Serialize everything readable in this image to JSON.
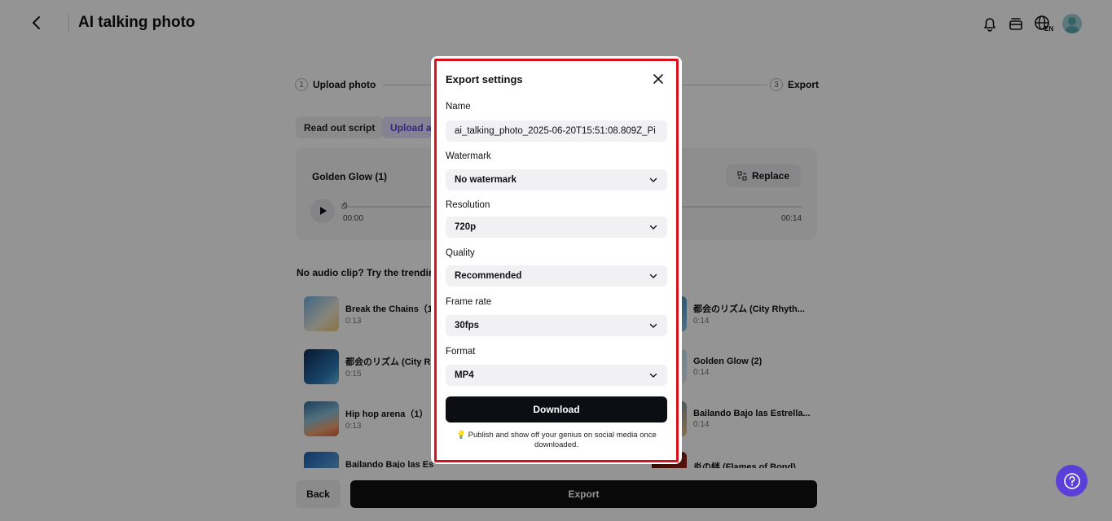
{
  "header": {
    "title": "AI talking photo",
    "icons": [
      "back-arrow-icon",
      "bell-icon",
      "layers-icon",
      "globe-language-icon",
      "avatar"
    ],
    "language_badge": "EN"
  },
  "steps": [
    {
      "num": "1",
      "label": "Upload photo"
    },
    {
      "num": "3",
      "label": "Export"
    }
  ],
  "tabs": {
    "read_out_script": "Read out script",
    "upload_audio": "Upload au"
  },
  "audio_card": {
    "name": "Golden Glow (1)",
    "replace_label": "Replace",
    "time_start": "00:00",
    "time_end": "00:14",
    "progress_marker": "0"
  },
  "trending": {
    "title": "No audio clip? Try the trending",
    "tracks_left": [
      {
        "name": "Break the Chains（1",
        "duration": "0:13"
      },
      {
        "name": "都会のリズム (City R",
        "duration": "0:15"
      },
      {
        "name": "Hip hop arena（1）",
        "duration": "0:13"
      },
      {
        "name": "Bailando Bajo las Es",
        "duration": ""
      }
    ],
    "tracks_right": [
      {
        "name": "都会のリズム (City Rhyth...",
        "duration": "0:14"
      },
      {
        "name": "Golden Glow (2)",
        "duration": "0:14"
      },
      {
        "name": "Bailando Bajo las Estrella...",
        "duration": "0:14"
      },
      {
        "name": "炎の絆 (Flames of Bond)...",
        "duration": ""
      }
    ]
  },
  "footer": {
    "back_label": "Back",
    "export_label": "Export"
  },
  "modal": {
    "title": "Export settings",
    "name_label": "Name",
    "name_value": "ai_talking_photo_2025-06-20T15:51:08.809Z_Pi",
    "watermark_label": "Watermark",
    "watermark_value": "No watermark",
    "resolution_label": "Resolution",
    "resolution_value": "720p",
    "quality_label": "Quality",
    "quality_value": "Recommended",
    "framerate_label": "Frame rate",
    "framerate_value": "30fps",
    "format_label": "Format",
    "format_value": "MP4",
    "download_label": "Download",
    "tip_icon": "💡",
    "tip_text": "Publish and show off your genius on social media once downloaded."
  },
  "colors": {
    "accent": "#5a3fd9",
    "highlight_border": "#d8111a",
    "primary_button": "#0d0d14"
  }
}
